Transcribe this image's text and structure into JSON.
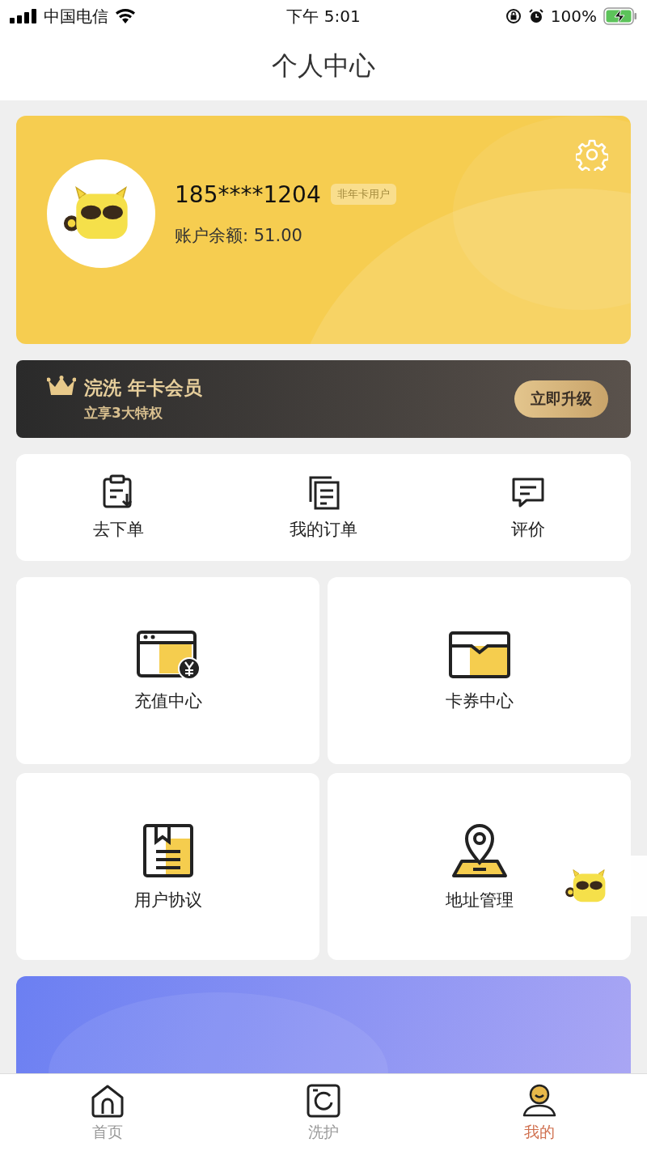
{
  "status_bar": {
    "carrier": "中国电信",
    "time": "下午 5:01",
    "battery": "100%"
  },
  "header": {
    "title": "个人中心"
  },
  "profile": {
    "phone": "185****1204",
    "badge": "非年卡用户",
    "balance": "账户余额: 51.00"
  },
  "membership": {
    "title": "浣洗 年卡会员",
    "subtitle": "立享3大特权",
    "button": "立即升级"
  },
  "quick_actions": [
    {
      "kind": "order",
      "label": "去下单"
    },
    {
      "kind": "orders",
      "label": "我的订单"
    },
    {
      "kind": "review",
      "label": "评价"
    }
  ],
  "services": [
    {
      "kind": "recharge",
      "label": "充值中心"
    },
    {
      "kind": "coupons",
      "label": "卡券中心"
    },
    {
      "kind": "agreement",
      "label": "用户协议"
    },
    {
      "kind": "address",
      "label": "地址管理"
    }
  ],
  "tab_bar": [
    {
      "kind": "home",
      "label": "首页",
      "selected": false
    },
    {
      "kind": "wash",
      "label": "洗护",
      "selected": false
    },
    {
      "kind": "me",
      "label": "我的",
      "selected": true
    }
  ]
}
